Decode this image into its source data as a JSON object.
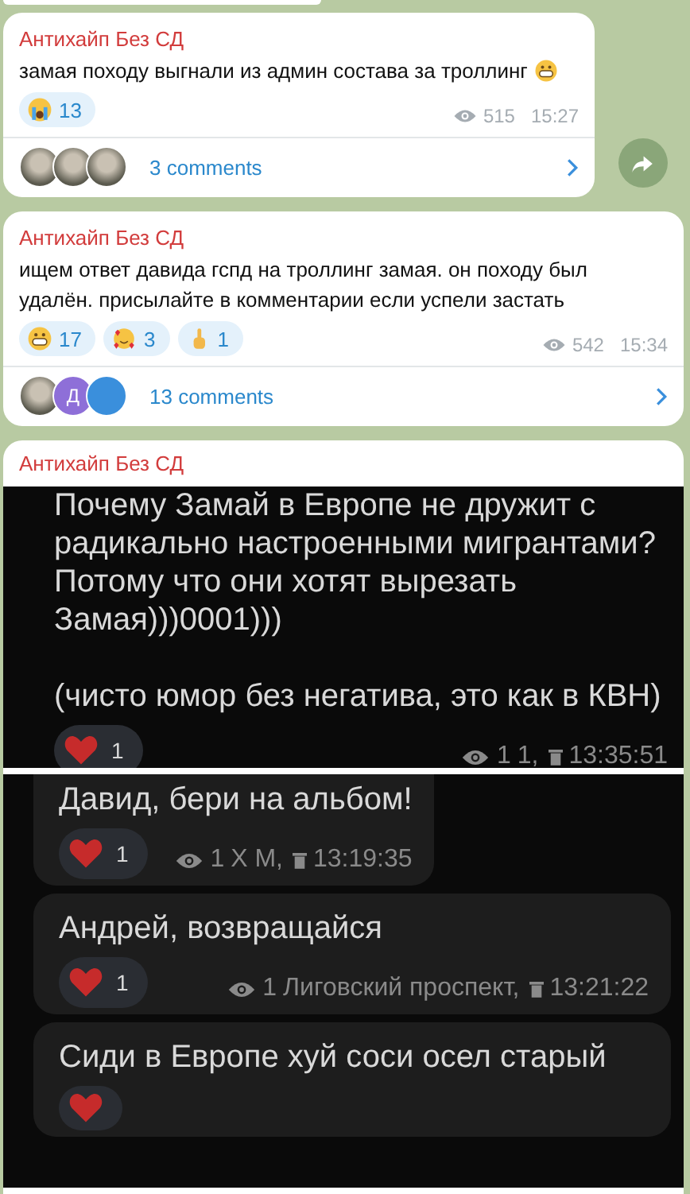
{
  "posts": [
    {
      "channel": "Антихайп Без СД",
      "text": "замая походу выгнали из админ состава за троллинг",
      "emoji_after": true,
      "reactions": [
        {
          "kind": "crying",
          "count": "13"
        }
      ],
      "views": "515",
      "time": "15:27",
      "comments": {
        "avatars": [
          {
            "kind": "photo"
          },
          {
            "kind": "photo"
          },
          {
            "kind": "photo"
          }
        ],
        "label": "3 comments"
      },
      "forward": true
    },
    {
      "channel": "Антихайп Без СД",
      "text": "ищем ответ давида гспд на троллинг замая. он походу был удалён. присылайте в комментарии если успели застать",
      "reactions": [
        {
          "kind": "grin",
          "count": "17"
        },
        {
          "kind": "hearts",
          "count": "3"
        },
        {
          "kind": "finger",
          "count": "1"
        }
      ],
      "views": "542",
      "time": "15:34",
      "comments": {
        "avatars": [
          {
            "kind": "photo"
          },
          {
            "kind": "letter",
            "letter": "Д",
            "color": "#8e6fd8"
          },
          {
            "kind": "plain",
            "color": "#3a8fdc"
          }
        ],
        "label": "13 comments"
      },
      "forward": false
    },
    {
      "channel": "Антихайп Без СД",
      "screenshots": [
        {
          "messages": [
            {
              "text": "Почему Замай в Европе не дружит с радикально настроенными мигрантами? Потому что они хотят вырезать Замая)))0001)))\n\n(чисто юмор без негатива, это как в КВН)",
              "reaction": "1",
              "views": "1",
              "signature": "1,",
              "time": "13:35:51"
            }
          ]
        },
        {
          "messages": [
            {
              "text": "Давид, бери на альбом!",
              "reaction": "1",
              "views": "1",
              "signature": "Х М,",
              "time": "13:19:35"
            },
            {
              "text": "Андрей, возвращайся",
              "reaction": "1",
              "views": "1",
              "signature": "Лиговский проспект,",
              "time": "13:21:22"
            },
            {
              "text": "Сиди в Европе хуй соси осел старый"
            }
          ]
        }
      ]
    }
  ]
}
